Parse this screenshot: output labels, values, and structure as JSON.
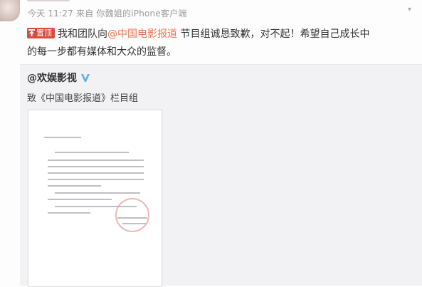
{
  "post": {
    "meta": "今天 11:27 来自 你魏姐的iPhone客户端",
    "top_label": "置顶",
    "text_1": "我和团队向",
    "mention": "@中国电影报道",
    "text_2": " 节目组诚恳致歉，对不起！希望自己成长中",
    "text_3": "的每一步都有媒体和大众的监督。"
  },
  "repost": {
    "author": "@欢娱影视",
    "text": "致《中国电影报道》栏目组"
  },
  "icons": [
    "avatar",
    "pin-icon",
    "verified-v-icon",
    "chevron-down-icon",
    "apology-letter-image"
  ],
  "colors": {
    "top_badge": "#d64b3e",
    "mention": "#eb7350",
    "verified": "#f6a623",
    "repost_bg": "#f2f2f5"
  }
}
